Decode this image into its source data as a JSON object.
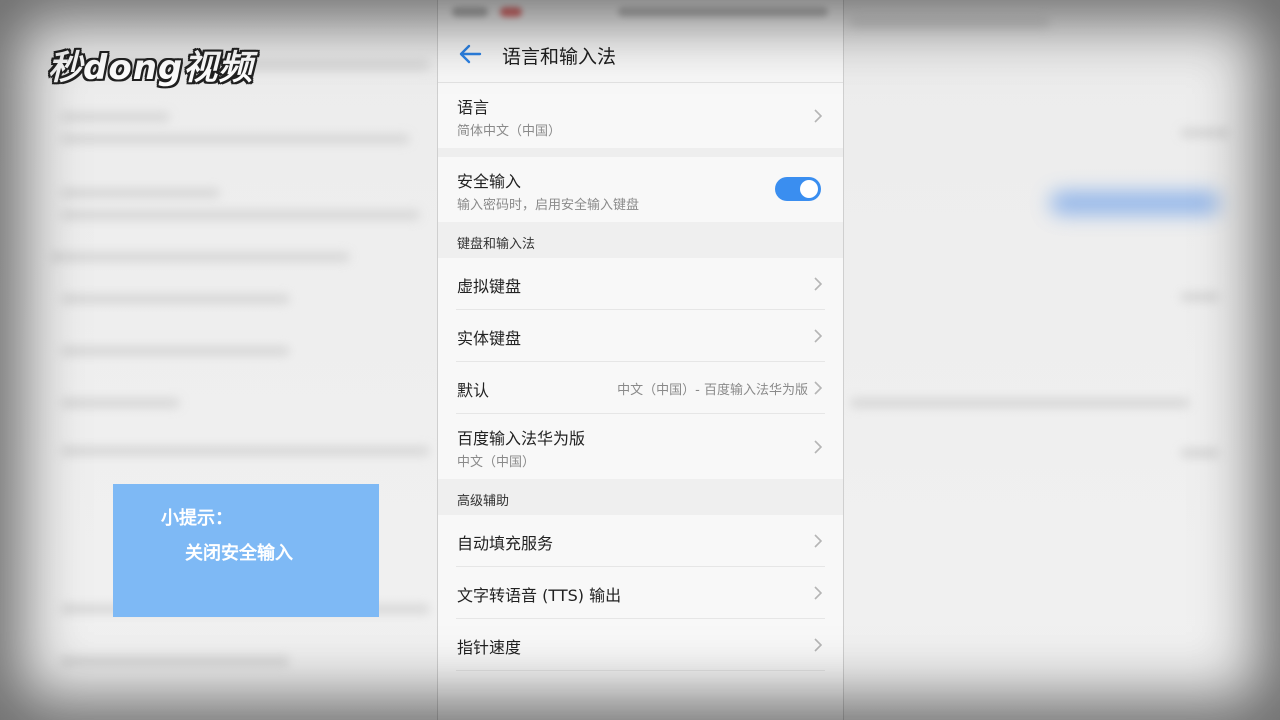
{
  "watermark": {
    "logo": "秒dong视频"
  },
  "tip": {
    "title": "小提示：",
    "text": "关闭安全输入"
  },
  "appbar": {
    "title": "语言和输入法",
    "back_icon": "arrow-left-icon",
    "accent": "#2d83e6"
  },
  "language": {
    "title": "语言",
    "value": "简体中文（中国）"
  },
  "secure_input": {
    "title": "安全输入",
    "subtitle": "输入密码时，启用安全输入键盘",
    "enabled": true,
    "toggle_color": "#3a8ef0"
  },
  "keyboard_section": {
    "header": "键盘和输入法",
    "items": [
      {
        "title": "虚拟键盘"
      },
      {
        "title": "实体键盘"
      },
      {
        "title": "默认",
        "value": "中文（中国）- 百度输入法华为版"
      },
      {
        "title": "百度输入法华为版",
        "subtitle": "中文（中国）"
      }
    ]
  },
  "advanced_section": {
    "header": "高级辅助",
    "items": [
      {
        "title": "自动填充服务"
      },
      {
        "title": "文字转语音 (TTS) 输出"
      },
      {
        "title": "指针速度"
      }
    ]
  }
}
